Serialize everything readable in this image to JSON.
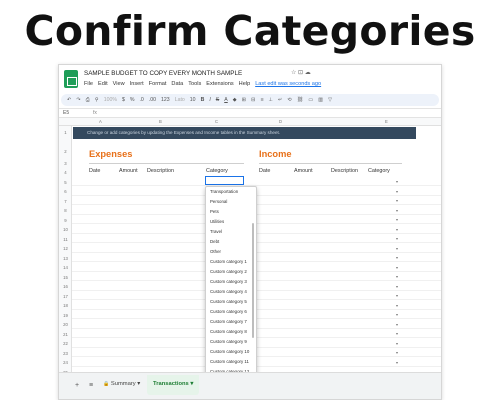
{
  "headline": "Confirm Categories",
  "doc": {
    "title": "SAMPLE BUDGET TO COPY EVERY MONTH SAMPLE",
    "title_icons": "☆ ⊡ ☁",
    "menu": [
      "File",
      "Edit",
      "View",
      "Insert",
      "Format",
      "Data",
      "Tools",
      "Extensions",
      "Help"
    ],
    "last_edit": "Last edit was seconds ago"
  },
  "toolbar": {
    "zoom": "100%",
    "currency": "$",
    "percent": "%",
    "dec_less": ".0",
    "dec_more": ".00",
    "format": "123",
    "font": "Lato",
    "font_size": "10",
    "bold": "B",
    "italic": "I",
    "strike": "S",
    "color": "A"
  },
  "formula_bar": {
    "cell": "E5",
    "fx": "fx"
  },
  "columns": [
    "A",
    "B",
    "C",
    "D",
    "E"
  ],
  "rows": [
    "1",
    "2",
    "3",
    "4",
    "5",
    "6",
    "7",
    "8",
    "9",
    "10",
    "11",
    "12",
    "13",
    "14",
    "15",
    "16",
    "17",
    "18",
    "19",
    "20",
    "21",
    "22",
    "23",
    "24",
    "25",
    "26",
    "27"
  ],
  "banner_text": "Change or add categories by updating the Expenses and Income tables in the Summary sheet.",
  "expenses": {
    "title": "Expenses",
    "headers": [
      "Date",
      "Amount",
      "Description",
      "Category"
    ]
  },
  "income": {
    "title": "Income",
    "headers": [
      "Date",
      "Amount",
      "Description",
      "Category"
    ]
  },
  "dropdown_options": [
    "Transportation",
    "Personal",
    "Pets",
    "Utilities",
    "Travel",
    "Debt",
    "Other",
    "Custom category 1",
    "Custom category 2",
    "Custom category 3",
    "Custom category 4",
    "Custom category 5",
    "Custom category 6",
    "Custom category 7",
    "Custom category 8",
    "Custom category 9",
    "Custom category 10",
    "Custom category 11",
    "Custom category 12"
  ],
  "sheet_tabs": {
    "add": "+",
    "all_sheets": "≡",
    "summary": "Summary",
    "transactions": "Transactions"
  },
  "icons": {
    "chevron": "▾",
    "pencil": "✎",
    "lock": "🔒"
  }
}
